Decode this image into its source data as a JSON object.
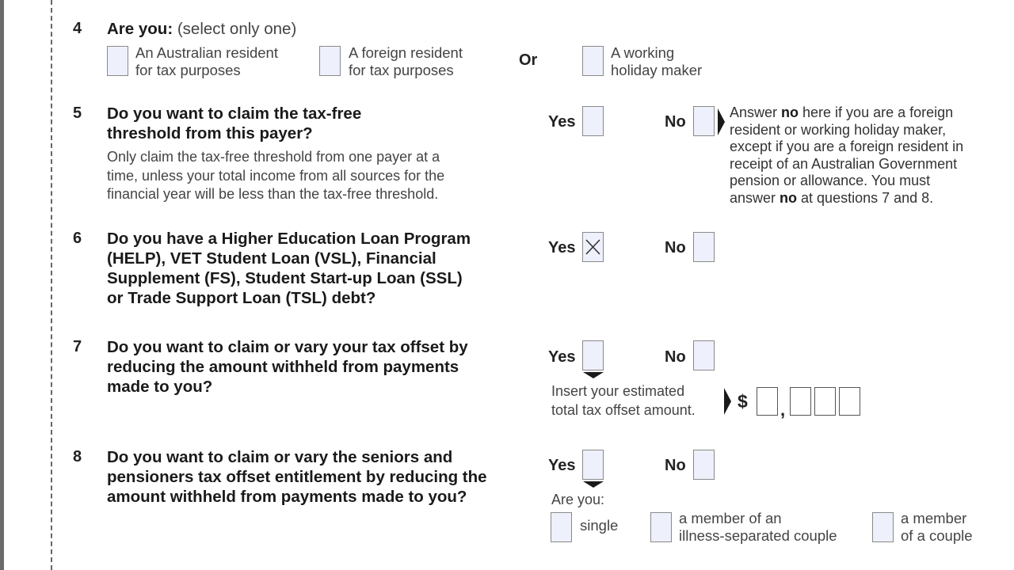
{
  "q4": {
    "number": "4",
    "title": "Are you:",
    "hint": "(select only one)",
    "options": [
      {
        "line1": "An Australian resident",
        "line2": "for tax purposes"
      },
      {
        "line1": "A foreign resident",
        "line2": "for tax purposes"
      },
      {
        "line1": "A working",
        "line2": "holiday maker"
      }
    ],
    "or": "Or"
  },
  "q5": {
    "number": "5",
    "title1": "Do you want to claim the tax-free",
    "title2": "threshold from this payer?",
    "body1": "Only claim the tax-free threshold from one payer at a",
    "body2": "time, unless your total income from all sources for the",
    "body3": "financial year will be less than the tax-free threshold.",
    "yes": "Yes",
    "no": "No",
    "note": {
      "pre": "Answer ",
      "bold1": "no",
      "mid1": " here if you are a foreign",
      "l2": "resident or working holiday maker,",
      "l3": "except if you are a foreign resident in",
      "l4": "receipt of an Australian Government",
      "l5": "pension or allowance. You must",
      "l6pre": "answer ",
      "bold2": "no",
      "l6post": " at questions 7 and 8."
    }
  },
  "q6": {
    "number": "6",
    "title1": "Do you have a Higher Education Loan Program",
    "title2": "(HELP), VET Student Loan (VSL), Financial",
    "title3": "Supplement (FS), Student Start-up Loan (SSL)",
    "title4": "or Trade Support Loan (TSL) debt?",
    "yes": "Yes",
    "no": "No",
    "yes_checked": true,
    "no_checked": false
  },
  "q7": {
    "number": "7",
    "title1": "Do you want to claim or vary your tax offset by",
    "title2": "reducing the amount withheld from payments",
    "title3": "made to you?",
    "yes": "Yes",
    "no": "No",
    "insert1": "Insert your estimated",
    "insert2": "total tax offset amount.",
    "currency": "$",
    "comma": ",",
    "amount": ""
  },
  "q8": {
    "number": "8",
    "title1": "Do you want to claim or vary the seniors and",
    "title2": "pensioners tax offset entitlement by reducing the",
    "title3": "amount withheld from payments made to you?",
    "yes": "Yes",
    "no": "No",
    "are_you": "Are you:",
    "options": [
      {
        "line1": "single"
      },
      {
        "line1": "a member of an",
        "line2": "illness-separated couple"
      },
      {
        "line1": "a member",
        "line2": "of a couple"
      }
    ]
  }
}
